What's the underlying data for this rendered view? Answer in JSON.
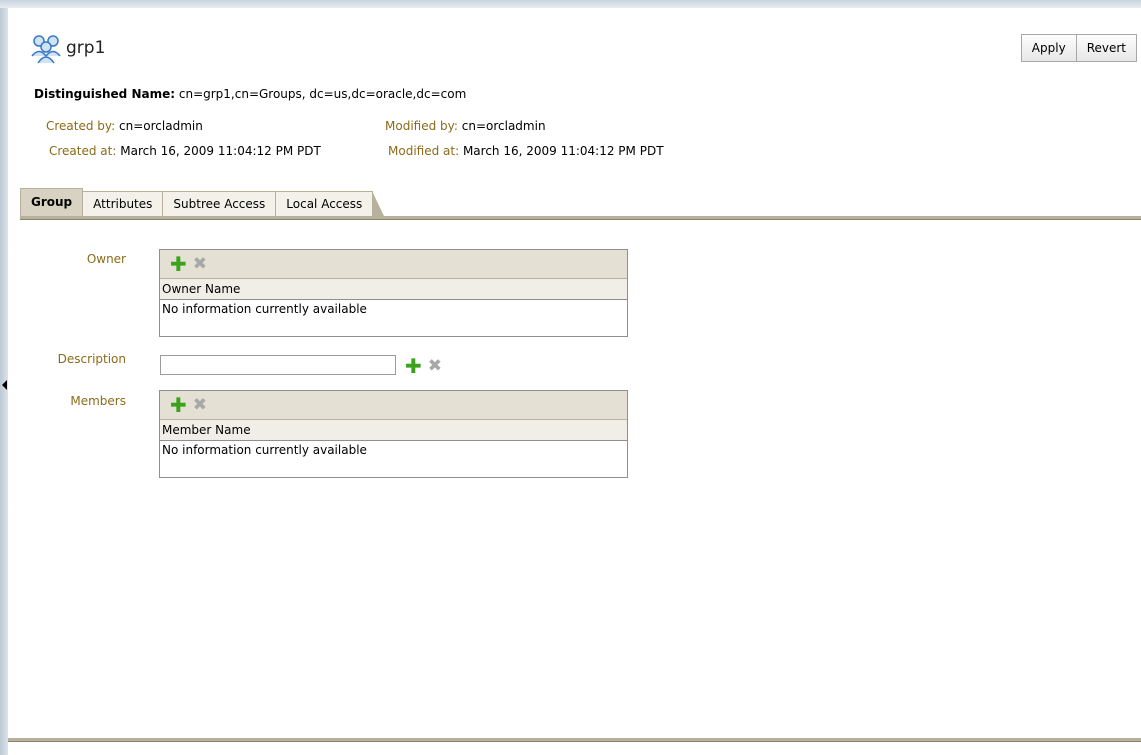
{
  "header": {
    "title": "grp1",
    "icon": "group-icon"
  },
  "actions": {
    "apply_label": "Apply",
    "revert_label": "Revert"
  },
  "dn": {
    "label": "Distinguished Name:",
    "value": "cn=grp1,cn=Groups, dc=us,dc=oracle,dc=com"
  },
  "meta": {
    "created_by_label": "Created by:",
    "created_by_value": "cn=orcladmin",
    "created_at_label": "Created at:",
    "created_at_value": "March 16, 2009 11:04:12 PM PDT",
    "modified_by_label": "Modified by:",
    "modified_by_value": "cn=orcladmin",
    "modified_at_label": "Modified at:",
    "modified_at_value": "March 16, 2009 11:04:12 PM PDT"
  },
  "tabs": [
    {
      "label": "Group",
      "active": true
    },
    {
      "label": "Attributes",
      "active": false
    },
    {
      "label": "Subtree Access",
      "active": false
    },
    {
      "label": "Local Access",
      "active": false
    }
  ],
  "owner": {
    "label": "Owner",
    "column": "Owner Name",
    "empty": "No information currently available"
  },
  "description": {
    "label": "Description",
    "value": ""
  },
  "members": {
    "label": "Members",
    "column": "Member Name",
    "empty": "No information currently available"
  },
  "colors": {
    "label": "#8a6b1a",
    "tab_line": "#b7b09b",
    "add_icon": "#3aa31b"
  }
}
